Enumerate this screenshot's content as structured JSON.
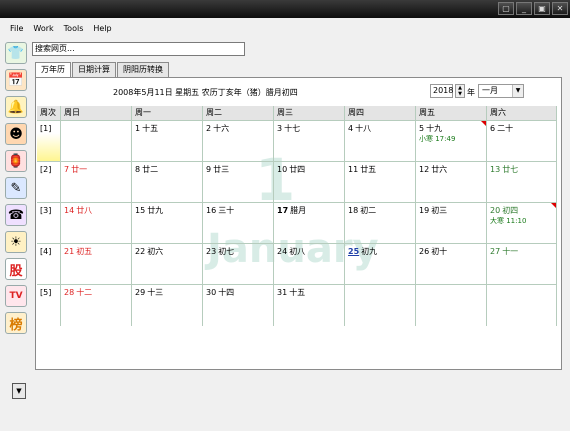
{
  "window": {
    "buttons": [
      "▢",
      "_",
      "▣",
      "✕"
    ]
  },
  "menu": [
    "File",
    "Work",
    "Tools",
    "Help"
  ],
  "sidebar": {
    "icons": [
      {
        "name": "shirt-icon",
        "glyph": "👕",
        "bg": "#e9f6e2"
      },
      {
        "name": "calendar-icon",
        "glyph": "📅",
        "bg": "#fde6c6"
      },
      {
        "name": "bell-icon",
        "glyph": "🔔",
        "bg": "#fff3bf"
      },
      {
        "name": "person-icon",
        "glyph": "☻",
        "bg": "#ffd7b0"
      },
      {
        "name": "lantern-icon",
        "glyph": "🏮",
        "bg": "#ffe0e0"
      },
      {
        "name": "note-icon",
        "glyph": "✎",
        "bg": "#dbe8ff"
      },
      {
        "name": "phone-icon",
        "glyph": "☎",
        "bg": "#efe0ff"
      },
      {
        "name": "weather-icon",
        "glyph": "☀",
        "bg": "#fff1c4"
      },
      {
        "name": "stock-icon",
        "glyph": "股",
        "bg": "#fff"
      },
      {
        "name": "tv-icon",
        "glyph": "TV",
        "bg": "#ffe6ec"
      },
      {
        "name": "ranking-icon",
        "glyph": "榜",
        "bg": "#fff0cc"
      }
    ],
    "expand": "▼"
  },
  "search": {
    "placeholder": "搜索网页..."
  },
  "tabs": [
    {
      "label": "万年历",
      "active": true
    },
    {
      "label": "日期计算",
      "active": false
    },
    {
      "label": "阴阳历转换",
      "active": false
    }
  ],
  "calendar": {
    "date_info": "2008年5月11日 星期五 农历丁亥年（猪）腊月初四",
    "year": "2018",
    "year_label": "年",
    "month": "一月",
    "watermark_number": "1",
    "watermark_word": "January",
    "headers": [
      "周次",
      "周日",
      "周一",
      "周二",
      "周三",
      "周四",
      "周五",
      "周六"
    ],
    "weeks": [
      {
        "no": "[1]",
        "highlight": true,
        "days": [
          null,
          {
            "d": "1",
            "l": "十五"
          },
          {
            "d": "2",
            "l": "十六"
          },
          {
            "d": "3",
            "l": "十七"
          },
          {
            "d": "4",
            "l": "十八"
          },
          {
            "d": "5",
            "l": "十九",
            "term": "小寒 17:49",
            "flag": true
          },
          {
            "d": "6",
            "l": "二十"
          }
        ]
      },
      {
        "no": "[2]",
        "days": [
          {
            "d": "7",
            "l": "廿一",
            "red": true
          },
          {
            "d": "8",
            "l": "廿二"
          },
          {
            "d": "9",
            "l": "廿三"
          },
          {
            "d": "10",
            "l": "廿四"
          },
          {
            "d": "11",
            "l": "廿五"
          },
          {
            "d": "12",
            "l": "廿六"
          },
          {
            "d": "13",
            "l": "廿七",
            "green": true
          }
        ]
      },
      {
        "no": "[3]",
        "days": [
          {
            "d": "14",
            "l": "廿八",
            "red": true
          },
          {
            "d": "15",
            "l": "廿九"
          },
          {
            "d": "16",
            "l": "三十"
          },
          {
            "d": "17",
            "l": "腊月",
            "bold": true
          },
          {
            "d": "18",
            "l": "初二"
          },
          {
            "d": "19",
            "l": "初三"
          },
          {
            "d": "20",
            "l": "初四",
            "green": true,
            "term": "大寒 11:10",
            "flag": true
          }
        ]
      },
      {
        "no": "[4]",
        "days": [
          {
            "d": "21",
            "l": "初五",
            "red": true
          },
          {
            "d": "22",
            "l": "初六"
          },
          {
            "d": "23",
            "l": "初七"
          },
          {
            "d": "24",
            "l": "初八"
          },
          {
            "d": "25",
            "l": "初九",
            "today": true
          },
          {
            "d": "26",
            "l": "初十"
          },
          {
            "d": "27",
            "l": "十一",
            "green": true
          }
        ]
      },
      {
        "no": "[5]",
        "days": [
          {
            "d": "28",
            "l": "十二",
            "red": true
          },
          {
            "d": "29",
            "l": "十三"
          },
          {
            "d": "30",
            "l": "十四"
          },
          {
            "d": "31",
            "l": "十五"
          },
          null,
          null,
          null
        ]
      }
    ]
  }
}
